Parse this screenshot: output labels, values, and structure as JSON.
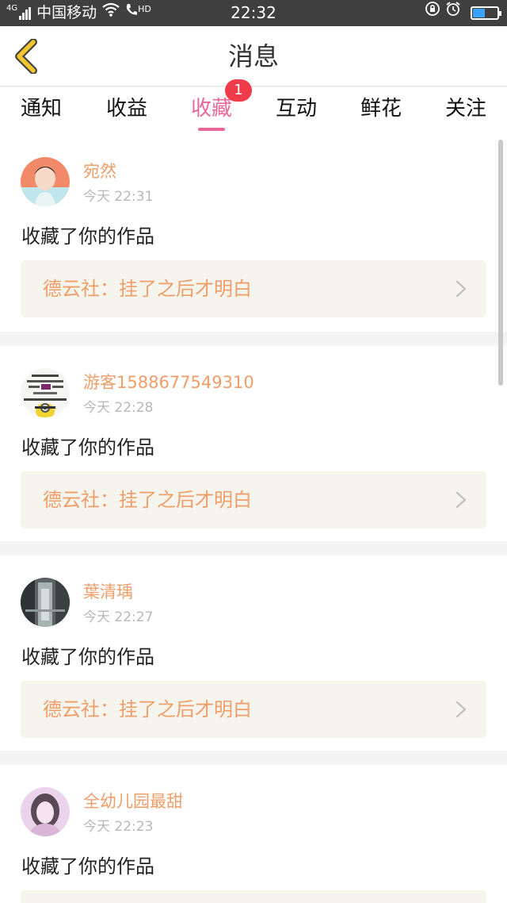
{
  "status_bar": {
    "network": "4G",
    "carrier": "中国移动",
    "hd": "HD",
    "time": "22:32"
  },
  "nav": {
    "title": "消息"
  },
  "tabs": [
    {
      "label": "通知"
    },
    {
      "label": "收益"
    },
    {
      "label": "收藏",
      "active": true,
      "badge": "1"
    },
    {
      "label": "互动"
    },
    {
      "label": "鲜花"
    },
    {
      "label": "关注"
    }
  ],
  "feed": [
    {
      "username": "宛然",
      "time": "今天 22:31",
      "action": "收藏了你的作品",
      "work_title": "德云社：挂了之后才明白"
    },
    {
      "username": "游客1588677549310",
      "time": "今天 22:28",
      "action": "收藏了你的作品",
      "work_title": "德云社：挂了之后才明白"
    },
    {
      "username": "葉清瑀",
      "time": "今天 22:27",
      "action": "收藏了你的作品",
      "work_title": "德云社：挂了之后才明白"
    },
    {
      "username": "全幼儿园最甜",
      "time": "今天 22:23",
      "action": "收藏了你的作品",
      "work_title": ""
    }
  ],
  "colors": {
    "accent": "#e8689a",
    "username": "#ef9e6a",
    "badge": "#f03c4a",
    "back_icon": "#f3c52d"
  }
}
